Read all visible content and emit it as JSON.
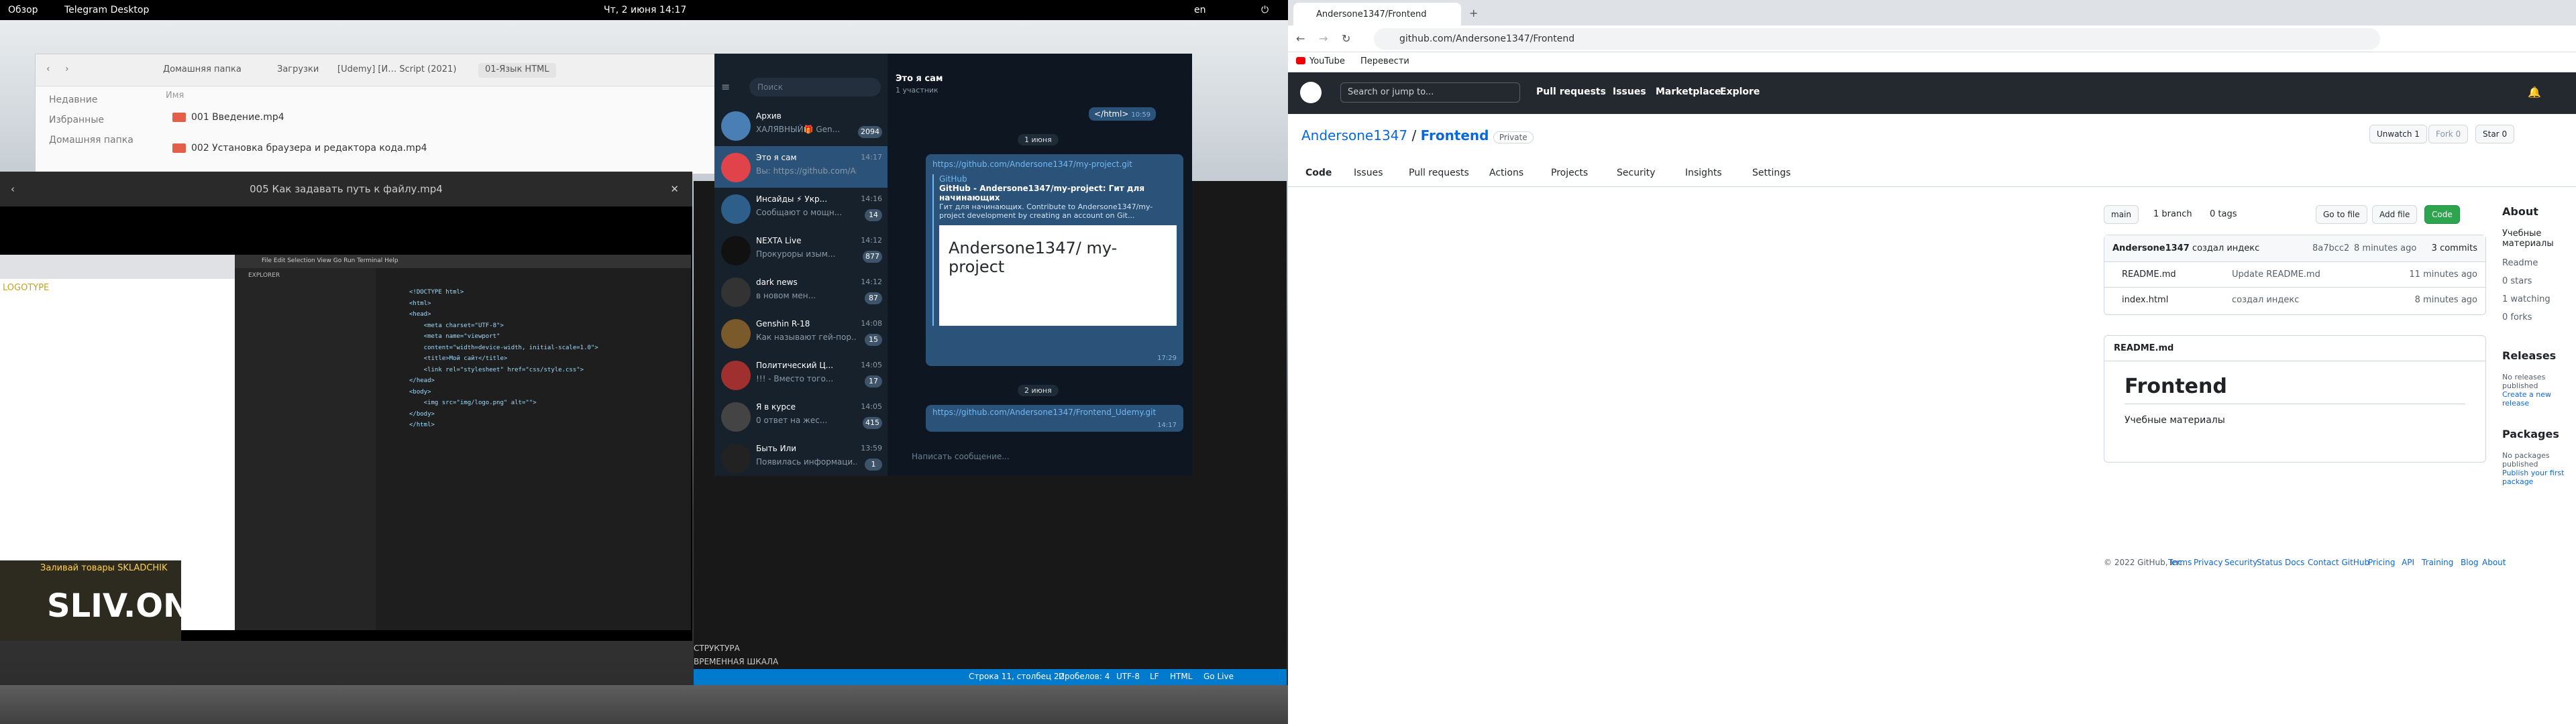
{
  "top_bar": {
    "overview": "Обзор",
    "app": "Telegram Desktop",
    "datetime": "Чт, 2 июня  14:17",
    "lang": "en"
  },
  "files": {
    "path": [
      "Домашняя папка",
      "Загрузки",
      "[Udemy] [И… Script (2021)",
      "01-Язык HTML"
    ],
    "column": "Имя",
    "sidebar": [
      "Недавние",
      "Избранные",
      "Домашняя папка"
    ],
    "items": [
      "001 Введение.mp4",
      "002 Установка браузера и редактора кода.mp4"
    ]
  },
  "video": {
    "title": "005 Как задавать путь к файлу.mp4",
    "logo_text": "LOGOTYPE",
    "watermark": "SLIV.ONE",
    "watermark_sub": "Заливай товары SKLADCHIK"
  },
  "vscode_embed": {
    "menu": "File  Edit  Selection  View  Go  Run  Terminal  Help",
    "explorer": "EXPLORER",
    "code": "<!DOCTYPE html>\n<html>\n<head>\n    <meta charset=\"UTF-8\">\n    <meta name=\"viewport\"\n    content=\"width=device-width, initial-scale=1.0\">\n    <title>Мой сайт</title>\n    <link rel=\"stylesheet\" href=\"css/style.css\">\n</head>\n<body>\n    <img src=\"img/logo.png\" alt=\"\">\n</body>\n</html>"
  },
  "telegram": {
    "search": "Поиск",
    "chat_title": "Это я сам",
    "chat_sub": "1 участник",
    "date1": "1 июня",
    "date2": "2 июня",
    "input": "Написать сообщение...",
    "chats": [
      {
        "t": "Архив",
        "s": "ХАЛЯВНЫЙ🎁  Gen...",
        "tm": "",
        "b": "2094",
        "c": "#4a7fb5"
      },
      {
        "t": "Это я сам",
        "s": "Вы: https://github.com/And...",
        "tm": "14:17",
        "b": "",
        "c": "#e0434a"
      },
      {
        "t": "Инсайды ⚡ Укр...",
        "s": "Сообщают о мощн...",
        "tm": "14:16",
        "b": "14",
        "c": "#2e5f8a"
      },
      {
        "t": "NEXTA Live",
        "s": "Прокуроры изым...",
        "tm": "14:12",
        "b": "877",
        "c": "#111"
      },
      {
        "t": "dark news",
        "s": "в новом мен...",
        "tm": "14:12",
        "b": "87",
        "c": "#333"
      },
      {
        "t": "Genshin R-18",
        "s": "Как называют гей-пор...",
        "tm": "14:08",
        "b": "15",
        "c": "#7a5a2a"
      },
      {
        "t": "Политический Ц...",
        "s": "!!! - Вместо того...",
        "tm": "14:05",
        "b": "17",
        "c": "#a03030"
      },
      {
        "t": "Я в курсе",
        "s": "0 ответ на жес...",
        "tm": "14:05",
        "b": "415",
        "c": "#444"
      },
      {
        "t": "Быть Или",
        "s": "Появилась информаци...",
        "tm": "13:59",
        "b": "1",
        "c": "#222"
      }
    ],
    "msg_link": "https://github.com/Andersone1347/my-project.git",
    "preview_site": "GitHub",
    "preview_title": "GitHub - Andersone1347/my-project: Гит для начинающих",
    "preview_desc": "Гит для начинающих. Contribute to Andersone1347/my-project development by creating an account on Git...",
    "card_title": "Andersone1347/ my-project",
    "card_time": "17:29",
    "msg2": "https://github.com/Andersone1347/Frontend_Udemy.git",
    "msg2_time": "14:17",
    "top_msg": "</html>",
    "top_time": "10:59"
  },
  "ide_status": {
    "pos": "Строка 11, столбец 22",
    "spaces": "Пробелов: 4",
    "enc": "UTF-8",
    "eol": "LF",
    "lang": "HTML",
    "live": "Go Live",
    "outline": "СТРУКТУРА",
    "timeline": "ВРЕМЕННАЯ ШКАЛА"
  },
  "browser": {
    "tab": "Andersone1347/Frontend",
    "url": "github.com/Andersone1347/Frontend",
    "bookmarks": [
      "YouTube",
      "Перевести"
    ]
  },
  "github": {
    "search": "Search or jump to...",
    "nav": [
      "Pull requests",
      "Issues",
      "Marketplace",
      "Explore"
    ],
    "owner": "Andersone1347",
    "repo": "Frontend",
    "visibility": "Private",
    "unwatch": "Unwatch",
    "unwatch_n": "1",
    "fork": "Fork",
    "fork_n": "0",
    "star": "Star",
    "star_n": "0",
    "tabs": [
      "Code",
      "Issues",
      "Pull requests",
      "Actions",
      "Projects",
      "Security",
      "Insights",
      "Settings"
    ],
    "branch": "main",
    "branches": "1 branch",
    "tags": "0 tags",
    "goto": "Go to file",
    "add": "Add file",
    "code_btn": "Code",
    "commit_user": "Andersone1347",
    "commit_msg": "создал индекс",
    "commit_hash": "8a7bcc2",
    "commit_time": "8 minutes ago",
    "commits": "3 commits",
    "files": [
      {
        "n": "README.md",
        "m": "Update README.md",
        "t": "11 minutes ago"
      },
      {
        "n": "index.html",
        "m": "создал индекс",
        "t": "8 minutes ago"
      }
    ],
    "readme_label": "README.md",
    "readme_h": "Frontend",
    "readme_p": "Учебные материалы",
    "about": "About",
    "about_desc": "Учебные материалы",
    "about_items": [
      "Readme",
      "0 stars",
      "1 watching",
      "0 forks"
    ],
    "releases": "Releases",
    "no_releases": "No releases published",
    "create_release": "Create a new release",
    "packages": "Packages",
    "no_packages": "No packages published",
    "publish": "Publish your first package",
    "footer": [
      "© 2022 GitHub, Inc.",
      "Terms",
      "Privacy",
      "Security",
      "Status",
      "Docs",
      "Contact GitHub",
      "Pricing",
      "API",
      "Training",
      "Blog",
      "About"
    ]
  }
}
